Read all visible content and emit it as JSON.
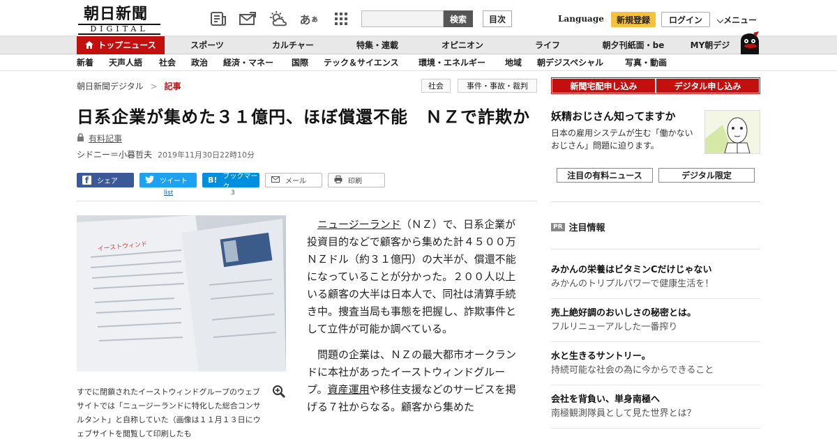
{
  "header": {
    "logo_kanji": "朝日新聞",
    "logo_sub": "DIGITAL",
    "icons": [
      "newspaper-icon",
      "envelope-icon",
      "weather-icon",
      "hiragana-icon",
      "grid-icon"
    ],
    "search_button": "検索",
    "toc_button": "目次",
    "language": "Language",
    "register": "新規登録",
    "login": "ログイン",
    "menu": "メニュー"
  },
  "nav_main": [
    "トップニュース",
    "スポーツ",
    "カルチャー",
    "特集・連載",
    "オピニオン",
    "ライフ",
    "朝夕刊紙面・be",
    "MY朝デジ"
  ],
  "nav_sub": [
    "新着",
    "天声人語",
    "社会",
    "政治",
    "経済・マネー",
    "国際",
    "テック＆サイエンス",
    "環境・エネルギー",
    "地域",
    "朝デジスペシャル",
    "写真・動画"
  ],
  "breadcrumb": {
    "home": "朝日新聞デジタル",
    "sep": ">",
    "current": "記事"
  },
  "tags": [
    "社会",
    "事件・事故・裁判"
  ],
  "article": {
    "headline": "日系企業が集めた３１億円、ほぼ償還不能　ＮＺで詐欺か",
    "paid_label": "有料記事",
    "byline": "シドニー＝小暮哲夫",
    "date": "2019年11月30日22時10分",
    "share": {
      "facebook": "シェア",
      "twitter": "ツイート",
      "twitter_count": "list",
      "hatena": "ブックマーク",
      "hatena_count": "3",
      "mail": "メール",
      "print": "印刷"
    },
    "caption": "すでに閉鎖されたイーストウィンドグループのウェブサイトでは「ニュージーランドに特化した総合コンサルタント」と自称していた（画像は１１月１３日にウェブサイトを閲覧して印刷したも",
    "p1_link": "ニュージーランド",
    "p1_rest": "（ＮＺ）で、日系企業が投資目的などで顧客から集めた計４５００万ＮＺドル（約３１億円）の大半が、償還不能になっていることが分かった。２００人以上いる顧客の大半は日本人で、同社は清算手続き中。捜査当局も事態を把握し、詐欺事件として立件が可能か調べている。",
    "p2_a": "問題の企業は、ＮＺの最大都市オークランドに本社があったイーストウィンドグループ。",
    "p2_link": "資産運用",
    "p2_b": "や移住支援などのサービスを掲げる７社からなる。顧客から集めた"
  },
  "sidebar": {
    "sub_buttons": [
      "新聞宅配申し込み",
      "デジタル申し込み"
    ],
    "promo_title": "妖精おじさん知ってますか",
    "promo_text": "日本の雇用システムが生む「働かないおじさん」問題に迫ります。",
    "tabs": [
      "注目の有料ニュース",
      "デジタル限定"
    ],
    "pr_badge": "PR",
    "pr_title": "注目情報",
    "ads": [
      {
        "title": "みかんの栄養はビタミンCだけじゃない",
        "sub": "みかんのトリプルパワーで健康生活を！"
      },
      {
        "title": "売上絶好調のおいしさの秘密とは。",
        "sub": "フルリニューアルした一番搾り"
      },
      {
        "title": "水と生きるサントリー。",
        "sub": "持続可能な社会の為に今からできること"
      },
      {
        "title": "会社を背負い、単身南極へ",
        "sub": "南極観測隊員として見た世界とは？"
      }
    ]
  },
  "colors": {
    "brand_red": "#c40f0f",
    "register_yellow": "#f6c23c",
    "facebook": "#3b5998",
    "twitter": "#1da1f2",
    "hatena": "#008fde"
  }
}
